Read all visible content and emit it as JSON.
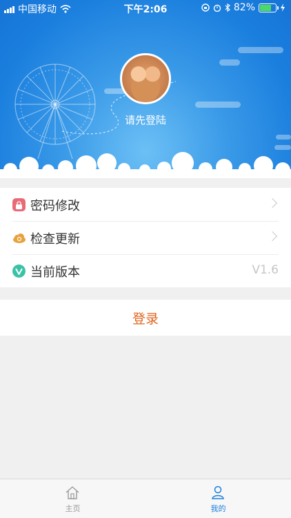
{
  "status_bar": {
    "carrier": "中国移动",
    "time": "下午2:06",
    "battery_percent": "82%",
    "battery_level": 0.82,
    "text_color": "#ffffff"
  },
  "profile": {
    "avatar_icon": "avatar-photo",
    "login_prompt": "请先登陆"
  },
  "menu": {
    "items": [
      {
        "label": "密码修改",
        "icon": "lock-icon",
        "icon_color": "#e86a75",
        "has_chevron": true
      },
      {
        "label": "检查更新",
        "icon": "cloud-refresh-icon",
        "icon_color": "#e8a23c",
        "has_chevron": true
      },
      {
        "label": "当前版本",
        "icon": "v-icon",
        "icon_color": "#3bc2a6",
        "value": "V1.6"
      }
    ]
  },
  "login_button": {
    "label": "登录",
    "color": "#e0641c"
  },
  "tabbar": {
    "tabs": [
      {
        "label": "主页",
        "icon": "home-icon",
        "active": false,
        "color": "#999999"
      },
      {
        "label": "我的",
        "icon": "user-icon",
        "active": true,
        "color": "#1a7fdd"
      }
    ]
  },
  "colors": {
    "header_blue": "#1b7fde",
    "background": "#f0f0f0"
  }
}
